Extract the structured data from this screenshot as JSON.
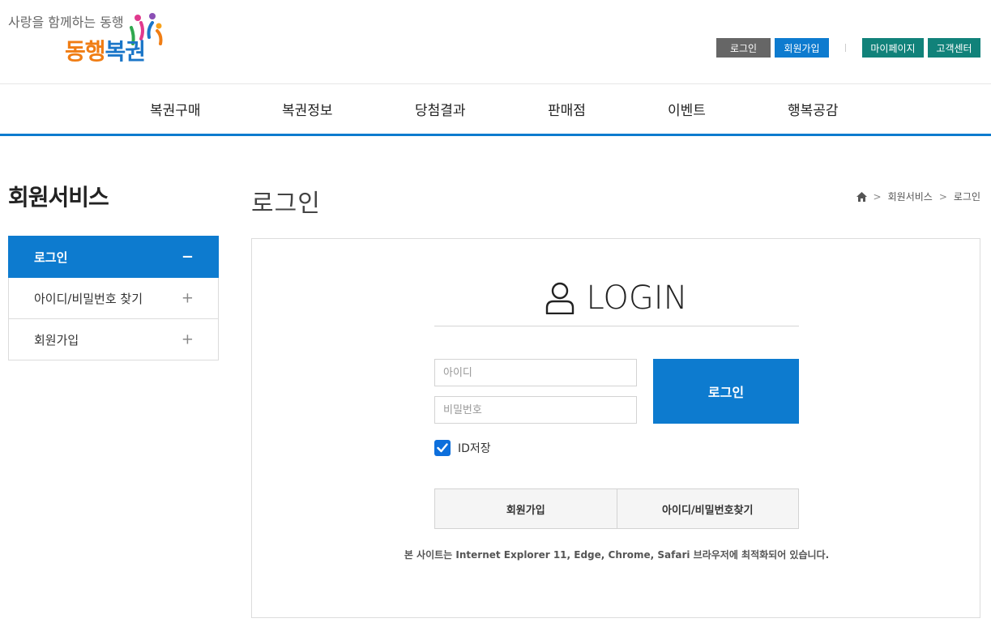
{
  "logo": {
    "slogan": "사랑을 함께하는 동행",
    "name_part1": "동행",
    "name_part2": "복권"
  },
  "util_nav": {
    "login": "로그인",
    "join": "회원가입",
    "mypage": "마이페이지",
    "customer": "고객센터"
  },
  "gnb": [
    "복권구매",
    "복권정보",
    "당첨결과",
    "판매점",
    "이벤트",
    "행복공감"
  ],
  "sidebar": {
    "title": "회원서비스",
    "items": [
      {
        "label": "로그인",
        "sign": "−"
      },
      {
        "label": "아이디/비밀번호 찾기",
        "sign": "+"
      },
      {
        "label": "회원가입",
        "sign": "+"
      }
    ]
  },
  "page": {
    "title": "로그인",
    "breadcrumb": [
      "회원서비스",
      "로그인"
    ]
  },
  "login": {
    "heading": "LOGIN",
    "id_placeholder": "아이디",
    "pw_placeholder": "비밀번호",
    "submit": "로그인",
    "save_id": "ID저장",
    "save_id_checked": true,
    "join": "회원가입",
    "find": "아이디/비밀번호찾기",
    "notice": "본 사이트는 Internet Explorer 11, Edge, Chrome, Safari 브라우저에 최적화되어 있습니다."
  },
  "colors": {
    "primary": "#0d7bcf",
    "green": "#11827a",
    "gray": "#666666"
  }
}
